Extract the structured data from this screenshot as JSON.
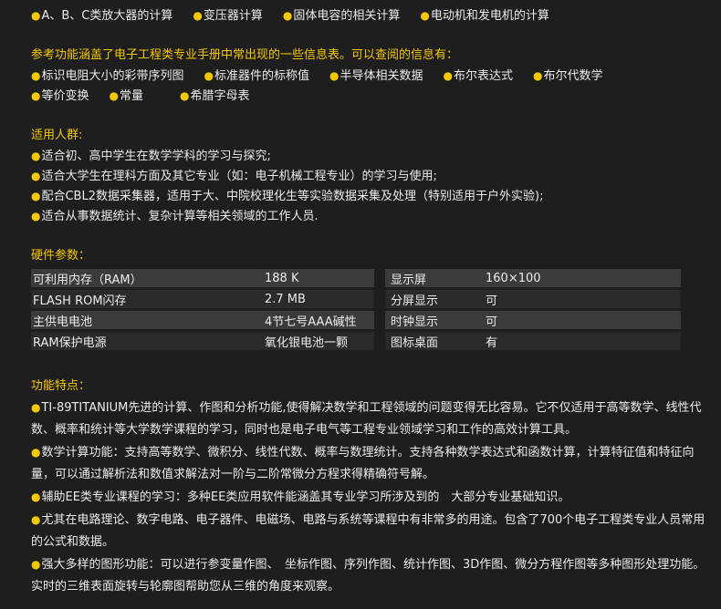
{
  "top_row": [
    "A、B、C类放大器的计算",
    "变压器计算",
    "固体电容的相关计算",
    "电动机和发电机的计算"
  ],
  "reference": {
    "heading": "参考功能涵盖了电子工程类专业手册中常出现的一些信息表。可以查阅的信息有：",
    "row1": [
      "标识电阻大小的彩带序列图",
      "标准器件的标称值",
      "半导体相关数据",
      "布尔表达式",
      "布尔代数学"
    ],
    "row2": [
      "等价变换",
      "常量",
      "希腊字母表"
    ]
  },
  "audience": {
    "heading": "适用人群:",
    "items": [
      "适合初、高中学生在数学学科的学习与探究;",
      "适合大学生在理科方面及其它专业（如：电子机械工程专业）的学习与使用;",
      "配合CBL2数据采集器，适用于大、中院校理化生等实验数据采集及处理（特别适用于户外实验);",
      "适合从事数据统计、复杂计算等相关领域的工作人员."
    ]
  },
  "hardware": {
    "heading": "硬件参数：",
    "rows": [
      {
        "k1": "可利用内存（RAM）",
        "v1": "188 K",
        "k2": "显示屏",
        "v2": "160×100"
      },
      {
        "k1": "FLASH ROM闪存",
        "v1": "2.7 MB",
        "k2": "分屏显示",
        "v2": "可"
      },
      {
        "k1": "主供电电池",
        "v1": "4节七号AAA碱性",
        "k2": "时钟显示",
        "v2": "可"
      },
      {
        "k1": "RAM保护电源",
        "v1": "氧化银电池一颗",
        "k2": "图标桌面",
        "v2": "有"
      }
    ]
  },
  "features": {
    "heading": "功能特点：",
    "items": [
      "TI-89TITANIUM先进的计算、作图和分析功能,使得解决数学和工程领域的问题变得无比容易。它不仅适用于高等数学、线性代数、概率和统计等大学数学课程的学习，同时也是电子电气等工程专业领域学习和工作的高效计算工具。",
      "数学计算功能：支持高等数学、微积分、线性代数、概率与数理统计。支持各种数学表达式和函数计算，计算特征值和特征向量，可以通过解析法和数值求解法对一阶与二阶常微分方程求得精确符号解。",
      "辅助EE类专业课程的学习：多种EE类应用软件能涵盖其专业学习所涉及到的　大部分专业基础知识。",
      "尤其在电路理论、数字电路、电子器件、电磁场、电路与系统等课程中有非常多的用途。包含了700个电子工程类专业人员常用的公式和数据。",
      "强大多样的图形功能：可以进行参变量作图、　坐标作图、序列作图、统计作图、3D作图、微分方程作图等多种图形处理功能。实时的三维表面旋转与轮廓图帮助您从三维的角度来观察。"
    ]
  }
}
